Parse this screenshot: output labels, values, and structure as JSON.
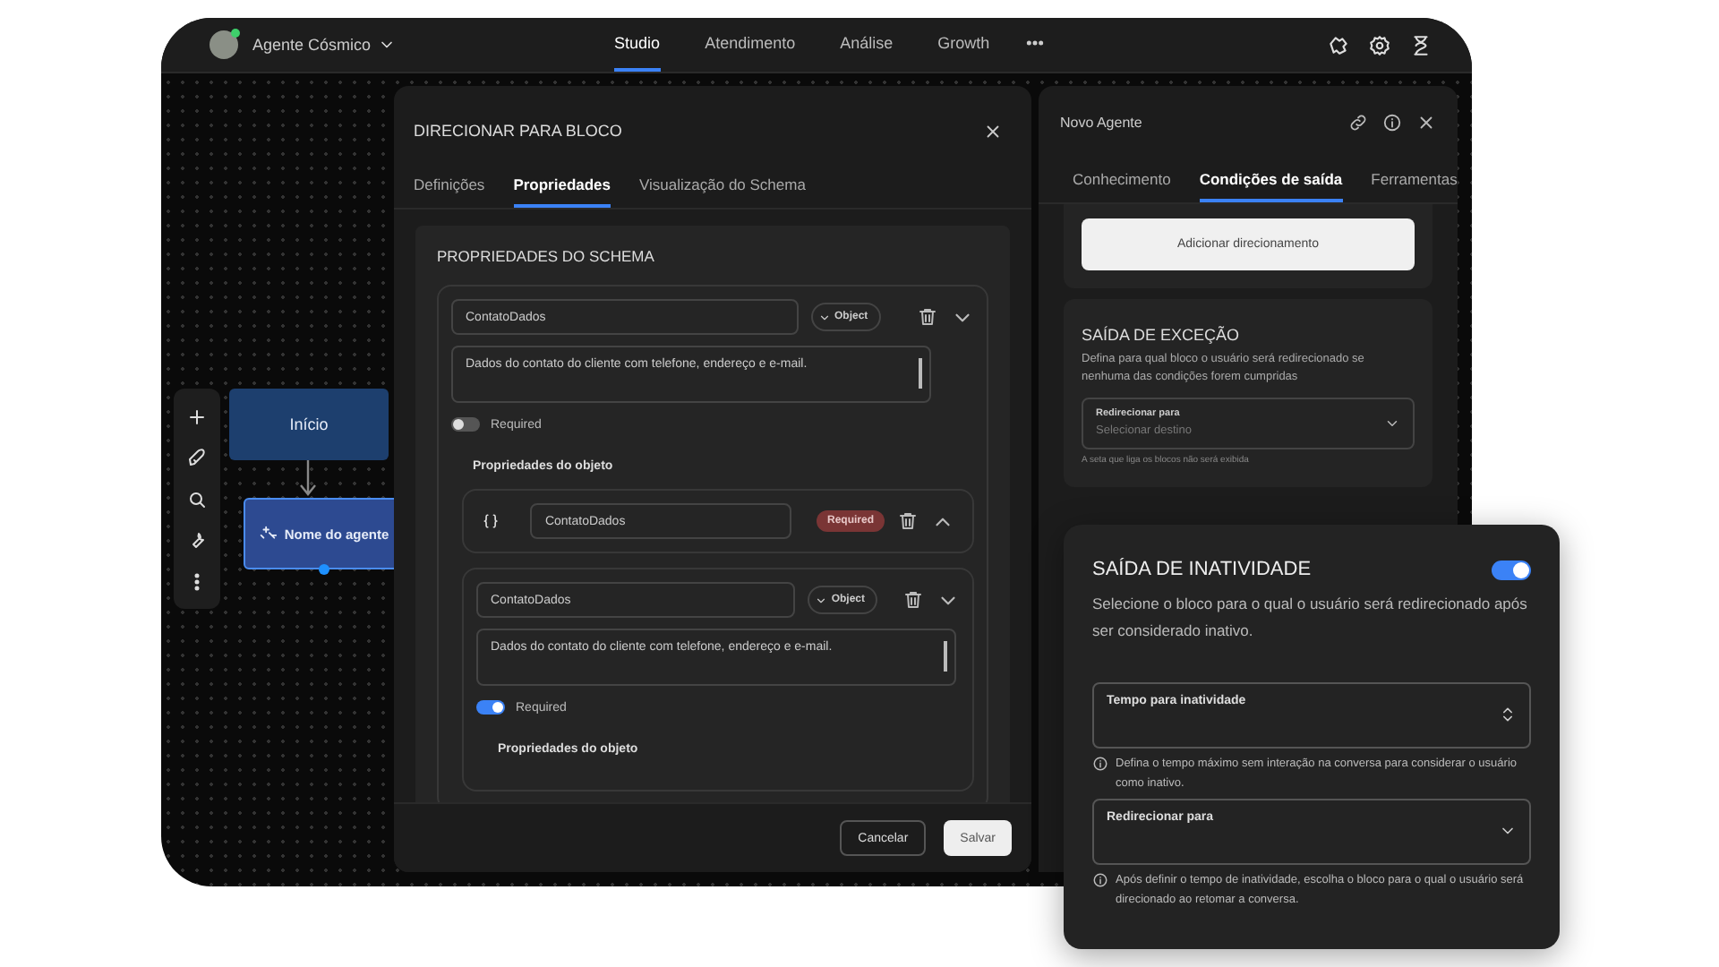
{
  "topbar": {
    "agent_name": "Agente Cósmico",
    "nav": [
      {
        "label": "Studio",
        "selected": true
      },
      {
        "label": "Atendimento",
        "selected": false
      },
      {
        "label": "Análise",
        "selected": false
      },
      {
        "label": "Growth",
        "selected": false
      }
    ]
  },
  "canvas": {
    "nodes": [
      {
        "label": "Início",
        "kind": "start"
      },
      {
        "label": "Nome do agente",
        "kind": "agent"
      }
    ]
  },
  "modal": {
    "title": "DIRECIONAR PARA BLOCO",
    "tabs": [
      {
        "label": "Definições",
        "selected": false
      },
      {
        "label": "Propriedades",
        "selected": true
      },
      {
        "label": "Visualização do Schema",
        "selected": false
      }
    ],
    "section_title": "PROPRIEDADES DO SCHEMA",
    "property": {
      "name": "ContatoDados",
      "type": "Object",
      "description": "Dados do contato do cliente com telefone, endereço e e-mail.",
      "required": false,
      "required_label": "Required",
      "nested_title": "Propriedades do objeto",
      "children": [
        {
          "kind": "compact",
          "name": "ContatoDados",
          "badge": "Required"
        },
        {
          "kind": "detailed",
          "name": "ContatoDados",
          "type": "Object",
          "description": "Dados do contato do cliente com telefone, endereço e e-mail.",
          "required": true,
          "required_label": "Required",
          "nested_title": "Propriedades do objeto"
        }
      ]
    },
    "buttons": [
      {
        "label": "Cancelar",
        "kind": "secondary"
      },
      {
        "label": "Salvar",
        "kind": "primary"
      }
    ]
  },
  "side_panel": {
    "title": "Novo Agente",
    "tabs": [
      {
        "label": "Conhecimento",
        "selected": false
      },
      {
        "label": "Condições de saída",
        "selected": true
      },
      {
        "label": "Ferramentas",
        "selected": false
      }
    ],
    "add_button": "Adicionar direcionamento",
    "exception": {
      "title": "SAÍDA DE EXCEÇÃO",
      "description": "Defina para qual bloco o usuário será redirecionado se nenhuma das condições forem cumpridas",
      "field_label": "Redirecionar para",
      "placeholder": "Selecionar destino",
      "hint": "A seta que liga os blocos não será exibida"
    }
  },
  "inactivity_card": {
    "title": "SAÍDA DE INATIVIDADE",
    "on": true,
    "description": "Selecione o bloco para o qual o usuário será redirecionado após ser considerado inativo.",
    "fields": [
      {
        "kind": "number",
        "label": "Tempo para inatividade",
        "hint": "Defina o tempo máximo sem interação na conversa para considerar o usuário como inativo."
      },
      {
        "kind": "select",
        "label": "Redirecionar para",
        "hint": "Após definir o tempo de inatividade, escolha o bloco para o qual o usuário será direcionado ao retomar a conversa."
      }
    ]
  }
}
